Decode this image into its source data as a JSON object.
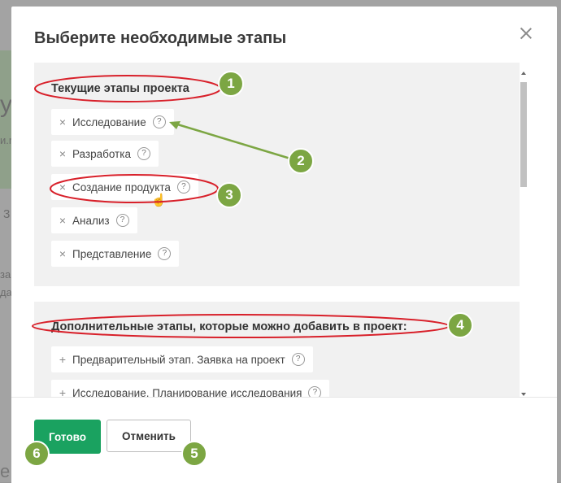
{
  "background": {
    "fragment_1": "y",
    "fragment_2": "и.r",
    "fragment_3": "3",
    "fragment_4": "за",
    "fragment_5": "да",
    "bottom_fragment": "е"
  },
  "modal": {
    "title": "Выберите необходимые этапы",
    "current_section": {
      "heading": "Текущие этапы проекта",
      "stages": [
        {
          "label": "Исследование"
        },
        {
          "label": "Разработка"
        },
        {
          "label": "Создание продукта"
        },
        {
          "label": "Анализ"
        },
        {
          "label": "Представление"
        }
      ]
    },
    "extra_section": {
      "heading": "Дополнительные этапы, которые можно добавить в проект:",
      "stages": [
        {
          "label": "Предварительный этап. Заявка на проект"
        },
        {
          "label": "Исследование. Планирование исследования"
        }
      ]
    },
    "footer": {
      "done_label": "Готово",
      "cancel_label": "Отменить"
    }
  },
  "annotations": {
    "badges": [
      "1",
      "2",
      "3",
      "4",
      "5",
      "6"
    ],
    "highlight_color": "#d8202a",
    "badge_color": "#7ca643"
  },
  "icons": {
    "remove": "×",
    "add": "+",
    "help": "?"
  }
}
